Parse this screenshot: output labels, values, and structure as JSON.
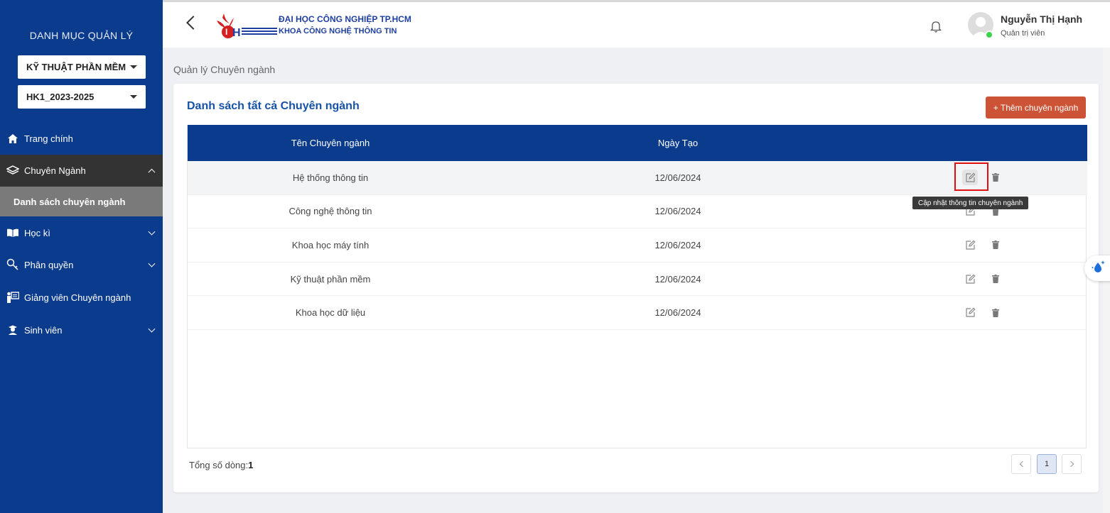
{
  "sidebar": {
    "title": "DANH MỤC QUẢN LÝ",
    "major_select": "KỸ THUẬT PHẦN MỀM",
    "semester_select": "HK1_2023-2025",
    "items": [
      {
        "label": "Trang chính",
        "icon": "home-icon"
      },
      {
        "label": "Chuyên Ngành",
        "icon": "layers-icon"
      },
      {
        "label": "Danh sách chuyên ngành"
      },
      {
        "label": "Học kì",
        "icon": "book-icon"
      },
      {
        "label": "Phân quyền",
        "icon": "key-icon"
      },
      {
        "label": "Giảng viên Chuyên ngành",
        "icon": "lecturer-icon"
      },
      {
        "label": "Sinh viên",
        "icon": "student-icon"
      }
    ]
  },
  "header": {
    "school_name": "ĐẠI HỌC CÔNG NGHIỆP TP.HCM",
    "faculty_name": "KHOA CÔNG NGHỆ THÔNG TIN",
    "user_name": "Nguyễn Thị Hạnh",
    "user_role": "Quản trị viên"
  },
  "page": {
    "title": "Quản lý Chuyên ngành",
    "card_title": "Danh sách tất cả Chuyên ngành",
    "add_button": "+ Thêm chuyên ngành"
  },
  "table": {
    "columns": [
      "Tên Chuyên ngành",
      "Ngày Tạo"
    ],
    "rows": [
      {
        "name": "Hệ thống thông tin",
        "date": "12/06/2024"
      },
      {
        "name": "Công nghệ thông tin",
        "date": "12/06/2024"
      },
      {
        "name": "Khoa học máy tính",
        "date": "12/06/2024"
      },
      {
        "name": "Kỹ thuật phần mềm",
        "date": "12/06/2024"
      },
      {
        "name": "Khoa học dữ liệu",
        "date": "12/06/2024"
      }
    ],
    "edit_tooltip": "Cập nhật thông tin chuyên ngành"
  },
  "footer": {
    "total_label": "Tổng số dòng:",
    "total_value": "1",
    "current_page": "1"
  },
  "colors": {
    "sidebar_bg": "#0b3b8c",
    "header_table": "#0b3b8c",
    "accent_button": "#cc5336",
    "online": "#3bd44a"
  }
}
